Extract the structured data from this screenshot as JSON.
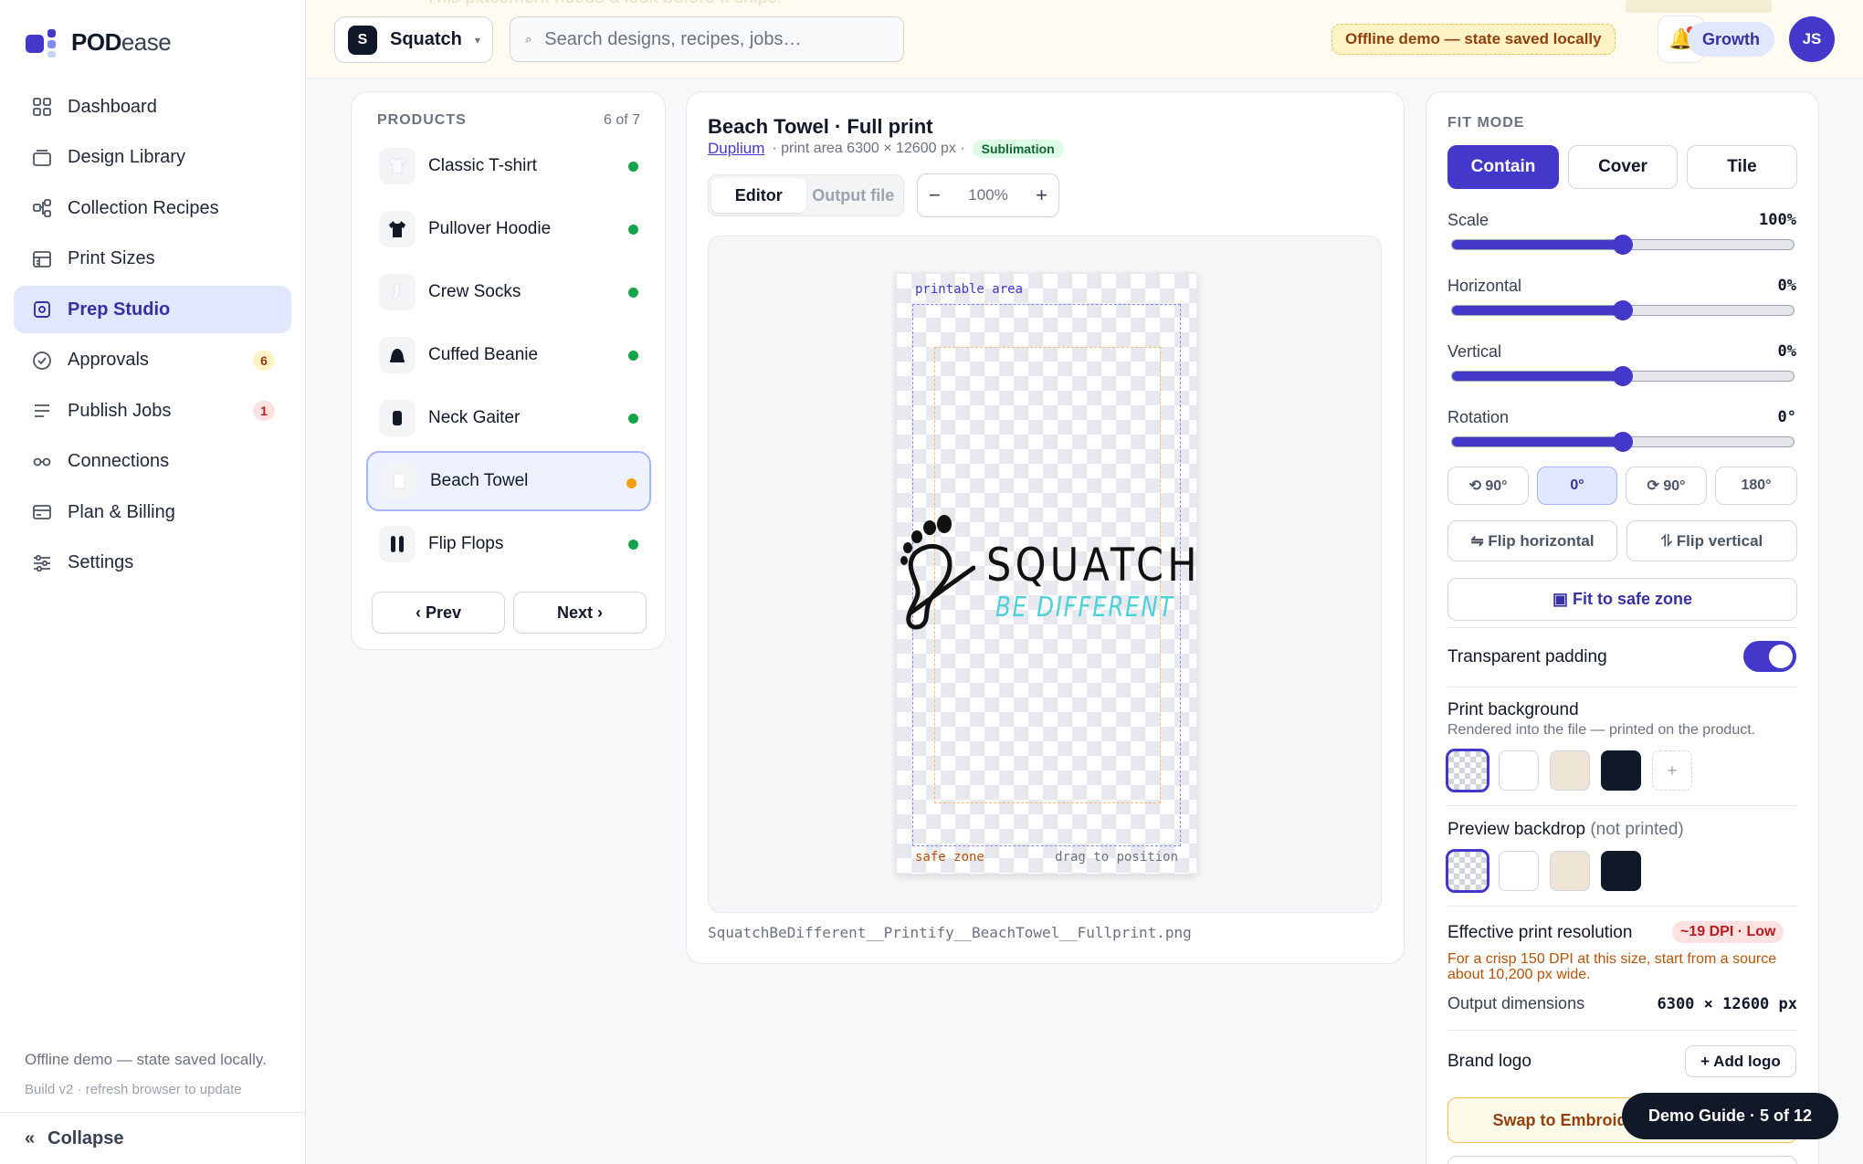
{
  "app": {
    "brand_bold": "POD",
    "brand_light": "ease"
  },
  "sidebar": {
    "items": [
      {
        "label": "Dashboard",
        "icon": "grid-icon"
      },
      {
        "label": "Design Library",
        "icon": "folder-icon"
      },
      {
        "label": "Collection Recipes",
        "icon": "recipe-nodes-icon"
      },
      {
        "label": "Print Sizes",
        "icon": "ruler-grid-icon"
      },
      {
        "label": "Prep Studio",
        "icon": "frame-target-icon",
        "active": true
      },
      {
        "label": "Approvals",
        "icon": "check-circle-icon",
        "badge": "6"
      },
      {
        "label": "Publish Jobs",
        "icon": "list-lines-icon",
        "badge": "1"
      },
      {
        "label": "Connections",
        "icon": "link-icon"
      },
      {
        "label": "Plan & Billing",
        "icon": "credit-card-icon"
      },
      {
        "label": "Settings",
        "icon": "sliders-icon"
      }
    ],
    "footer_status": "Offline demo — state saved locally.",
    "footer_build": "Build v2 · refresh browser to update",
    "collapse_icon": "«",
    "collapse_label": "Collapse"
  },
  "topbar": {
    "ghost_banner": "This placement needs a look before it ships.",
    "workspace_initial": "S",
    "workspace_name": "Squatch",
    "workspace_chevron": "▾",
    "search_icon": "⌕",
    "search_placeholder": "Search designs, recipes, jobs…",
    "offline_label": "Offline demo — state saved locally",
    "notification_icon": "🔔",
    "plan_label": "Growth",
    "user_initials": "JS"
  },
  "products": {
    "heading": "PRODUCTS",
    "count": "6 of 7",
    "items": [
      {
        "name": "Classic T-shirt",
        "status_color": "#16a34a"
      },
      {
        "name": "Pullover Hoodie",
        "status_color": "#16a34a"
      },
      {
        "name": "Crew Socks",
        "status_color": "#16a34a"
      },
      {
        "name": "Cuffed Beanie",
        "status_color": "#16a34a"
      },
      {
        "name": "Neck Gaiter",
        "status_color": "#16a34a"
      },
      {
        "name": "Beach Towel",
        "status_color": "#f59e0b",
        "selected": true
      },
      {
        "name": "Flip Flops",
        "status_color": "#16a34a"
      }
    ],
    "prev_label": "‹ Prev",
    "next_label": "Next ›"
  },
  "editor": {
    "title": "Beach Towel · Full print",
    "provider": "Duplium",
    "print_area": "· print area 6300 × 12600 px ·",
    "method_badge": "Sublimation",
    "tabs": [
      "Editor",
      "Output file"
    ],
    "zoom_minus": "−",
    "zoom_value": "100%",
    "zoom_plus": "+",
    "printable_label": "printable area",
    "safe_label": "safe zone",
    "drag_hint": "drag to position",
    "design_title": "SQUATCH",
    "design_tagline": "BE DIFFERENT",
    "output_filename": "SquatchBeDifferent__Printify__BeachTowel__Fullprint.png"
  },
  "panel": {
    "fit_heading": "FIT MODE",
    "fit_modes": [
      "Contain",
      "Cover",
      "Tile"
    ],
    "sliders": [
      {
        "label": "Scale",
        "value": "100%",
        "position": 0.5
      },
      {
        "label": "Horizontal",
        "value": "0%",
        "position": 0.5
      },
      {
        "label": "Vertical",
        "value": "0%",
        "position": 0.5
      },
      {
        "label": "Rotation",
        "value": "0°",
        "position": 0.5
      }
    ],
    "rotate_buttons": [
      "⟲ 90°",
      "0°",
      "⟳ 90°",
      "180°"
    ],
    "flip_h": "⇋ Flip horizontal",
    "flip_v": "⥮ Flip vertical",
    "safe_fit": "▣ Fit to safe zone",
    "transparent_padding": "Transparent padding",
    "print_bg_title": "Print background",
    "print_bg_sub": "Rendered into the file — printed on the product.",
    "add_swatch": "+",
    "preview_title": "Preview backdrop",
    "preview_note": "(not printed)",
    "swatch_colors": [
      "#ffffff",
      "#efe5d6",
      "#111827"
    ],
    "resolution_label": "Effective print resolution",
    "resolution_badge": "~19 DPI · Low",
    "resolution_warning": "For a crisp 150 DPI at this size, start from a source about 10,200 px wide.",
    "output_label": "Output dimensions",
    "output_value": "6300 × 12600 px",
    "brand_logo_label": "Brand logo",
    "add_logo": "+ Add logo",
    "swap_label": "Swap to Embroidery"
  },
  "guide": {
    "label": "Demo Guide · 5 of 12"
  }
}
